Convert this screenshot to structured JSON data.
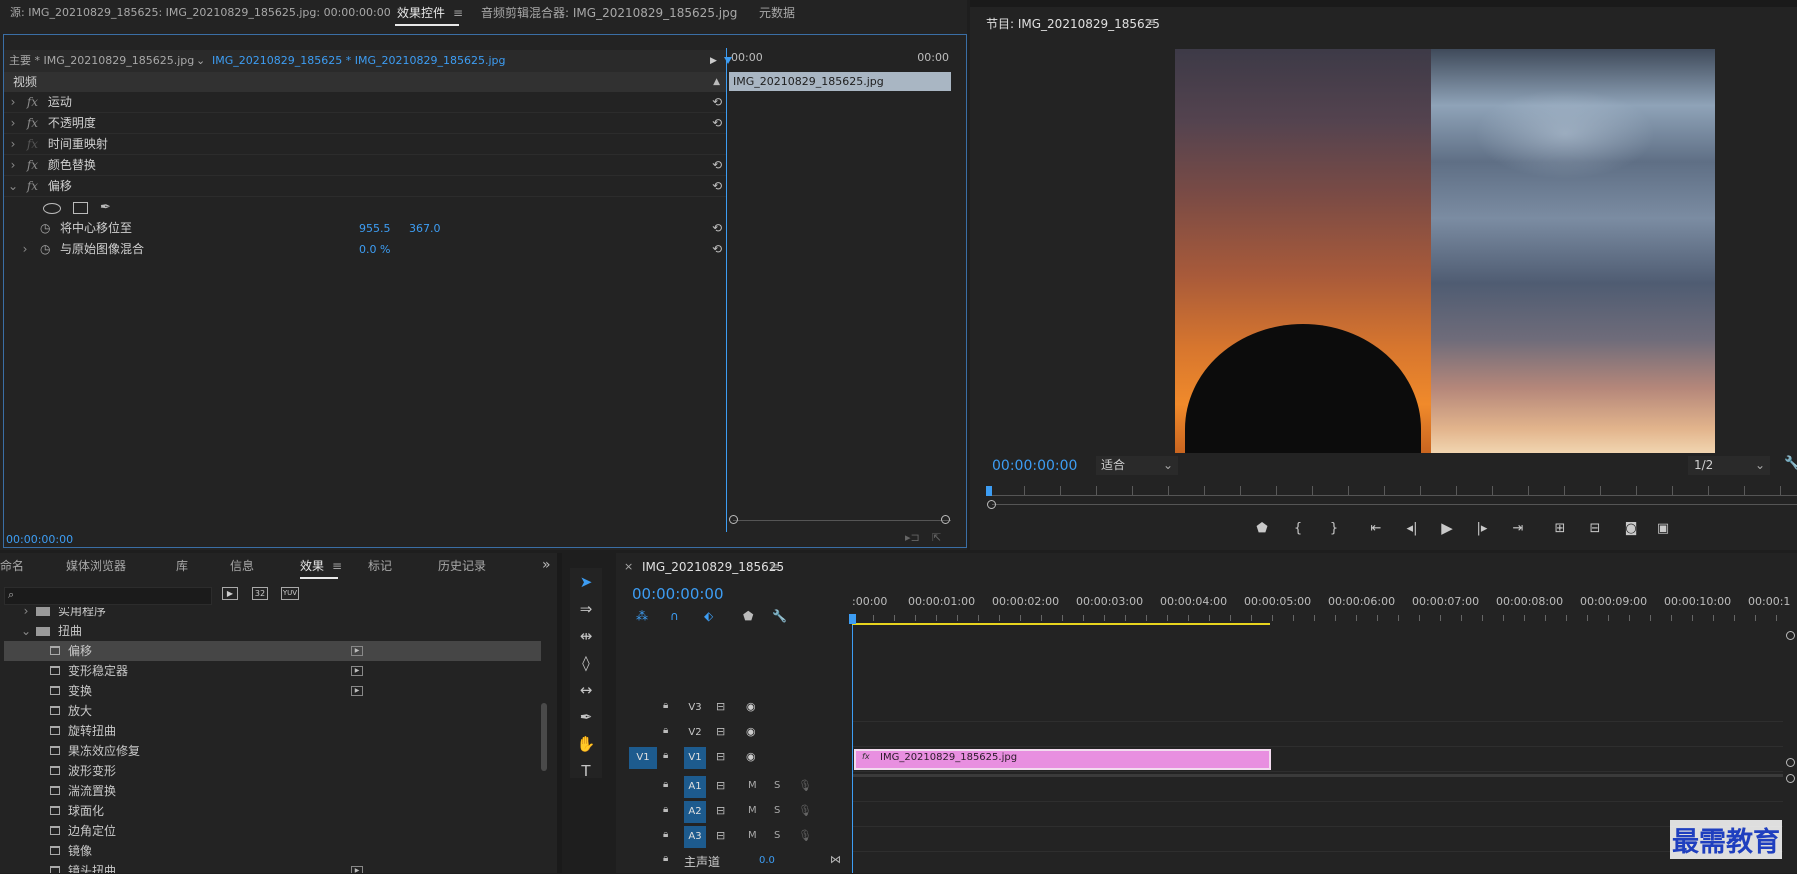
{
  "source_panel": {
    "tabs": [
      "源: IMG_20210829_185625: IMG_20210829_185625.jpg: 00:00:00:00",
      "效果控件",
      "音频剪辑混合器: IMG_20210829_185625.jpg",
      "元数据"
    ],
    "active_tab": "效果控件",
    "menu_icon": "≡",
    "master_label": "主要 * IMG_20210829_185625.jpg",
    "sequence_label": "IMG_20210829_185625 * IMG_20210829_185625.jpg",
    "time_start": "00:00",
    "time_end": "00:00",
    "clip_label": "IMG_20210829_185625.jpg",
    "section_video": "视频",
    "effects": [
      {
        "name": "运动",
        "reset": true
      },
      {
        "name": "不透明度",
        "reset": true
      },
      {
        "name": "时间重映射",
        "reset": false
      },
      {
        "name": "颜色替换",
        "reset": true
      },
      {
        "name": "偏移",
        "reset": true
      }
    ],
    "props": [
      {
        "name": "将中心移位至",
        "v1": "955.5",
        "v2": "367.0"
      },
      {
        "name": "与原始图像混合",
        "v1": "0.0 %",
        "v2": ""
      }
    ],
    "timecode": "00:00:00:00"
  },
  "program_panel": {
    "title": "节目: IMG_20210829_185625",
    "menu_icon": "≡",
    "timecode": "00:00:00:00",
    "fit_select": "适合",
    "resolution_select": "1/2"
  },
  "effects_panel": {
    "tabs": [
      "命名",
      "媒体浏览器",
      "库",
      "信息",
      "效果",
      "标记",
      "历史记录"
    ],
    "active_tab": "效果",
    "more_icon": "»",
    "folder_partial": "实用程序",
    "folder_distort": "扭曲",
    "items": [
      "偏移",
      "变形稳定器",
      "变换",
      "放大",
      "旋转扭曲",
      "果冻效应修复",
      "波形变形",
      "湍流置换",
      "球面化",
      "边角定位",
      "镜像",
      "镜头扭曲"
    ],
    "accelerated": [
      true,
      true,
      true,
      false,
      false,
      false,
      false,
      false,
      false,
      false,
      false,
      true
    ],
    "btn_labels": [
      "32",
      "YUV"
    ]
  },
  "timeline": {
    "sequence_name": "IMG_20210829_185625",
    "close_icon": "×",
    "menu_icon": "≡",
    "timecode": "00:00:00:00",
    "ruler": [
      ":00:00",
      "00:00:01:00",
      "00:00:02:00",
      "00:00:03:00",
      "00:00:04:00",
      "00:00:05:00",
      "00:00:06:00",
      "00:00:07:00",
      "00:00:08:00",
      "00:00:09:00",
      "00:00:10:00",
      "00:00:1"
    ],
    "video_tracks": [
      "V3",
      "V2",
      "V1"
    ],
    "source_patch": "V1",
    "audio_tracks": [
      "A1",
      "A2",
      "A3"
    ],
    "mute": "M",
    "solo": "S",
    "master_label": "主声道",
    "master_value": "0.0",
    "clip_label": "IMG_20210829_185625.jpg",
    "clip_fx": "fx"
  },
  "watermark": "最需教育",
  "colors": {
    "accent": "#3d9df3",
    "clip": "#e88fe0",
    "panel": "#232323"
  }
}
